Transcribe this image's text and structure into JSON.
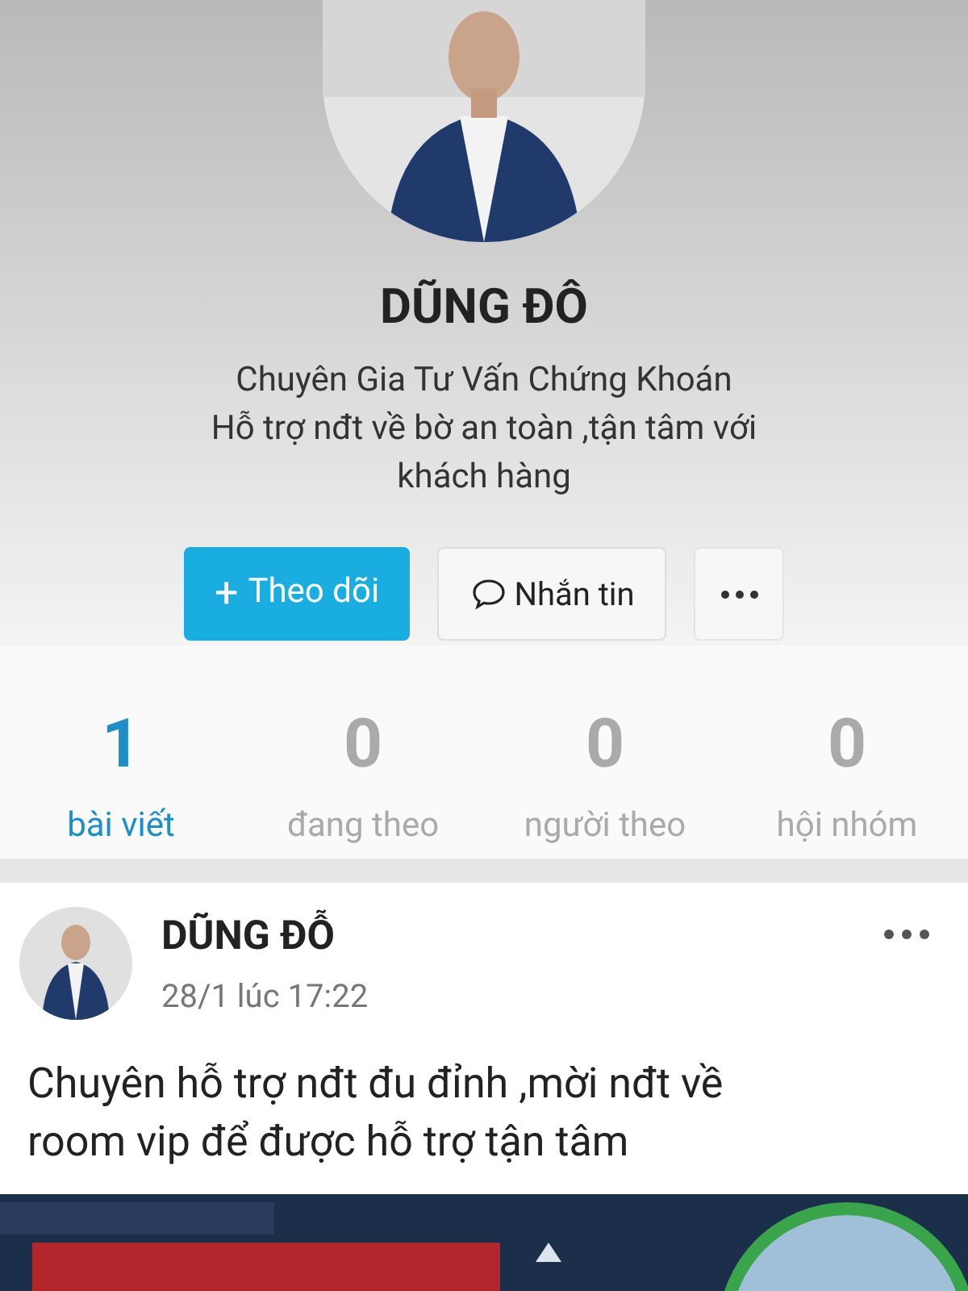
{
  "profile": {
    "name": "DŨNG ĐÔ",
    "bio": [
      "Chuyên Gia Tư Vấn Chứng Khoán",
      "Hỗ trợ nđt về bờ an toàn ,tận tâm với khách hàng"
    ]
  },
  "actions": [
    {
      "kind": "follow",
      "icon": "+",
      "label": "Theo dõi"
    },
    {
      "kind": "message",
      "label": "Nhắn tin"
    },
    {
      "kind": "more"
    }
  ],
  "stats": [
    {
      "value": "1",
      "label": "bài viết",
      "selected": true
    },
    {
      "value": "0",
      "label": "đang theo",
      "selected": false
    },
    {
      "value": "0",
      "label": "người theo",
      "selected": false
    },
    {
      "value": "0",
      "label": "hội nhóm",
      "selected": false
    }
  ],
  "post": {
    "author": "DŨNG ĐỖ",
    "time": "28/1 lúc 17:22",
    "text": "Chuyên hỗ trợ nđt đu đỉnh ,mời nđt về room vip để được hỗ trợ tận tâm"
  }
}
